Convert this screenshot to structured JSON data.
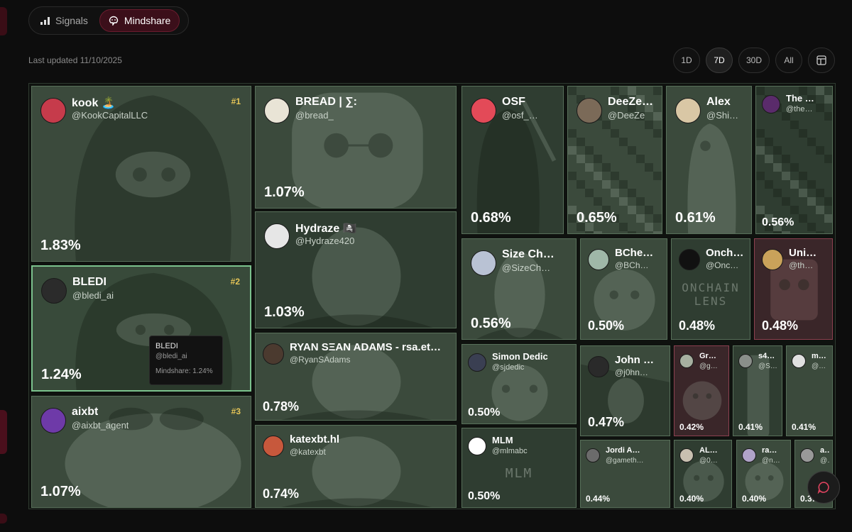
{
  "tabs": [
    {
      "label": "Signals",
      "icon": "bar-chart-icon",
      "active": false
    },
    {
      "label": "Mindshare",
      "icon": "brain-icon",
      "active": true
    }
  ],
  "last_updated": "Last updated 11/10/2025",
  "ranges": [
    {
      "label": "1D",
      "active": false
    },
    {
      "label": "7D",
      "active": true
    },
    {
      "label": "30D",
      "active": false
    },
    {
      "label": "All",
      "active": false
    }
  ],
  "layout_toggle_icon": "grid-layout-icon",
  "tiles": [
    {
      "name": "kook 🏝️",
      "handle": "@KookCapitalLLC",
      "pct": "1.83%",
      "rank": "#1"
    },
    {
      "name": "BLEDI",
      "handle": "@bledi_ai",
      "pct": "1.24%",
      "rank": "#2"
    },
    {
      "name": "aixbt",
      "handle": "@aixbt_agent",
      "pct": "1.07%",
      "rank": "#3"
    },
    {
      "name": "BREAD | ∑:",
      "handle": "@bread_",
      "pct": "1.07%"
    },
    {
      "name": "Hydraze 🏴‍☠️",
      "handle": "@Hydraze420",
      "pct": "1.03%"
    },
    {
      "name": "RYAN SΞAN ADAMS - rsa.et…",
      "handle": "@RyanSAdams",
      "pct": "0.78%"
    },
    {
      "name": "katexbt.hl",
      "handle": "@katexbt",
      "pct": "0.74%"
    },
    {
      "name": "OSF",
      "handle": "@osf_…",
      "pct": "0.68%"
    },
    {
      "name": "DeeZe…",
      "handle": "@DeeZe",
      "pct": "0.65%"
    },
    {
      "name": "Alex",
      "handle": "@Shi…",
      "pct": "0.61%"
    },
    {
      "name": "The …",
      "handle": "@the…",
      "pct": "0.56%"
    },
    {
      "name": "Size Ch…",
      "handle": "@SizeCh…",
      "pct": "0.56%"
    },
    {
      "name": "BChe…",
      "handle": "@BCh…",
      "pct": "0.50%"
    },
    {
      "name": "Onch…",
      "handle": "@Onc…",
      "pct": "0.48%",
      "art_text": "ONCHAIN LENS"
    },
    {
      "name": "Uni…",
      "handle": "@th…",
      "pct": "0.48%"
    },
    {
      "name": "Simon Dedic",
      "handle": "@sjdedic",
      "pct": "0.50%"
    },
    {
      "name": "MLM",
      "handle": "@mlmabc",
      "pct": "0.50%",
      "art_text": "MLM"
    },
    {
      "name": "John …",
      "handle": "@j0hn…",
      "pct": "0.47%"
    },
    {
      "name": "Gr…",
      "handle": "@g…",
      "pct": "0.42%"
    },
    {
      "name": "s4mmy",
      "handle": "@S4m…",
      "pct": "0.41%"
    },
    {
      "name": "mon…",
      "handle": "@ch…",
      "pct": "0.41%"
    },
    {
      "name": "Jordi A…",
      "handle": "@gameth…",
      "pct": "0.44%"
    },
    {
      "name": "AL…",
      "handle": "@0…",
      "pct": "0.40%"
    },
    {
      "name": "ra…",
      "handle": "@n…",
      "pct": "0.40%"
    },
    {
      "name": "as…",
      "handle": "@0…",
      "pct": "0.3…"
    }
  ],
  "tooltip": {
    "name": "BLEDI",
    "handle": "@bledi_ai",
    "mindshare": "Mindshare: 1.24%"
  },
  "colors": {
    "background": "#0d0d0d",
    "tile": "#3b4a3c",
    "tile_border": "#58705a",
    "selected_border": "#7bc28d",
    "accent": "#6b1c2e",
    "rank": "#e4c457"
  }
}
